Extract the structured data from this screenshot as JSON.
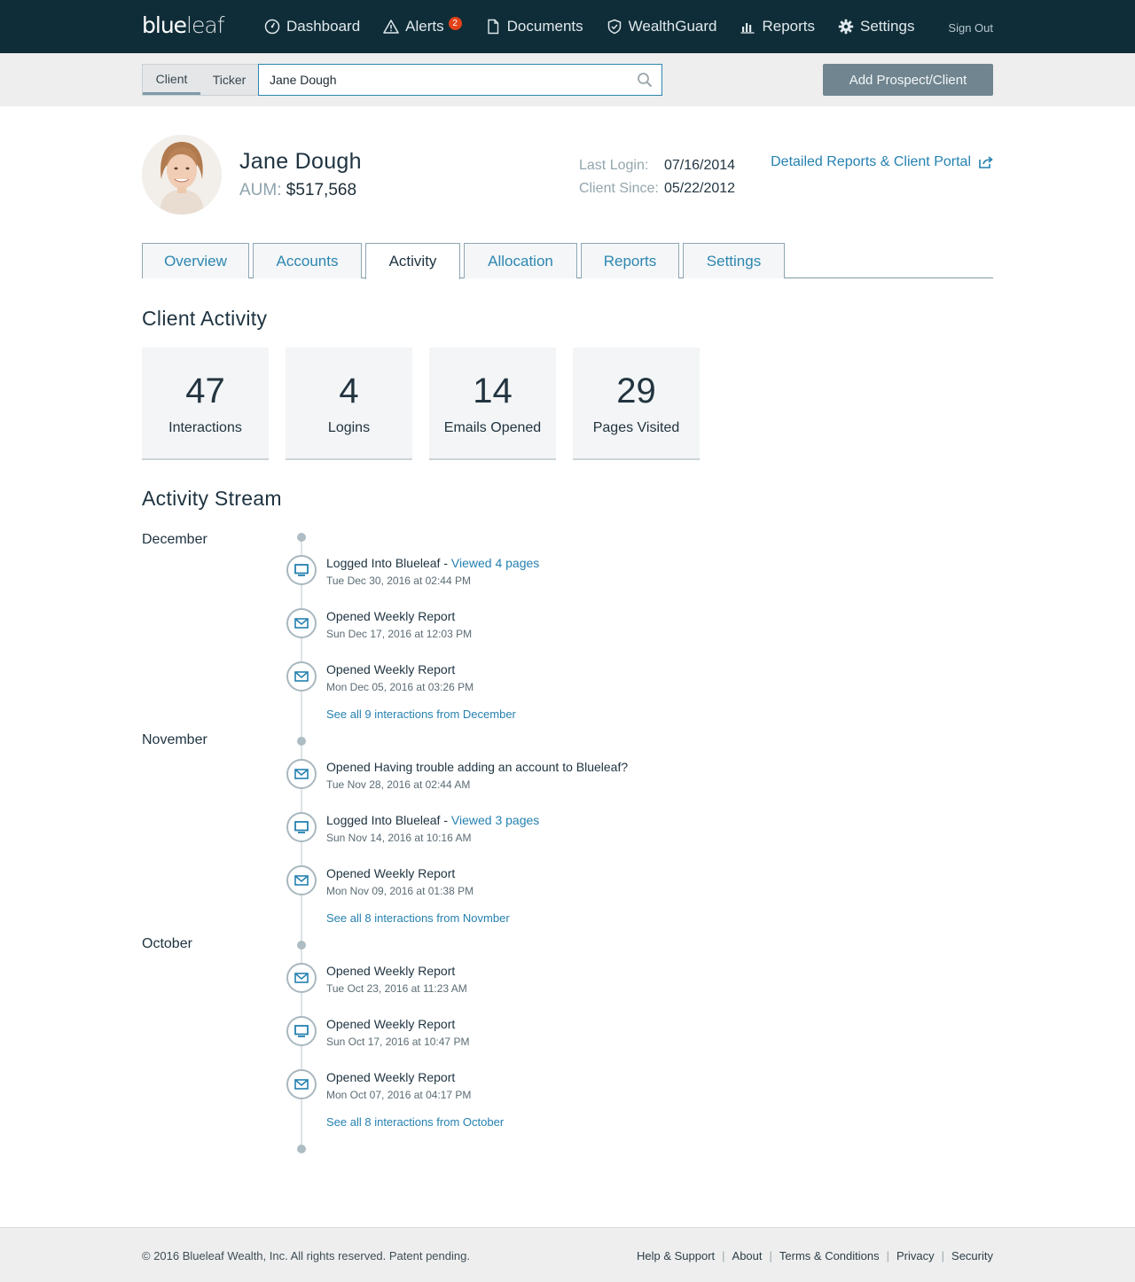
{
  "nav": {
    "logo_bold": "blue",
    "logo_thin": "leaf",
    "items": [
      {
        "label": "Dashboard",
        "icon": "dashboard-icon"
      },
      {
        "label": "Alerts",
        "icon": "alert-icon",
        "badge": "2"
      },
      {
        "label": "Documents",
        "icon": "document-icon"
      },
      {
        "label": "WealthGuard",
        "icon": "shield-icon"
      },
      {
        "label": "Reports",
        "icon": "bar-chart-icon"
      },
      {
        "label": "Settings",
        "icon": "gear-icon"
      }
    ],
    "sign_out": "Sign Out"
  },
  "search": {
    "toggle": [
      "Client",
      "Ticker"
    ],
    "active_toggle": "Client",
    "value": "Jane Dough",
    "add_button": "Add Prospect/Client"
  },
  "client": {
    "name": "Jane Dough",
    "aum_label": "AUM:",
    "aum_value": "$517,568",
    "last_login_label": "Last Login:",
    "last_login": "07/16/2014",
    "client_since_label": "Client Since:",
    "client_since": "05/22/2012",
    "portal_link": "Detailed Reports & Client Portal"
  },
  "tabs": [
    "Overview",
    "Accounts",
    "Activity",
    "Allocation",
    "Reports",
    "Settings"
  ],
  "active_tab": "Activity",
  "activity": {
    "heading": "Client Activity",
    "stats": [
      {
        "value": "47",
        "label": "Interactions"
      },
      {
        "value": "4",
        "label": "Logins"
      },
      {
        "value": "14",
        "label": "Emails Opened"
      },
      {
        "value": "29",
        "label": "Pages Visited"
      }
    ]
  },
  "stream": {
    "heading": "Activity Stream",
    "months": [
      {
        "name": "December",
        "events": [
          {
            "icon": "monitor-icon",
            "title": "Logged Into Blueleaf - ",
            "link": "Viewed 4 pages",
            "time": "Tue Dec 30, 2016 at 02:44 PM"
          },
          {
            "icon": "envelope-icon",
            "title": "Opened Weekly Report",
            "link": "",
            "time": "Sun Dec 17, 2016 at 12:03 PM"
          },
          {
            "icon": "envelope-icon",
            "title": "Opened Weekly Report",
            "link": "",
            "time": "Mon Dec 05, 2016 at 03:26 PM"
          }
        ],
        "see_all": "See all 9 interactions from December"
      },
      {
        "name": "November",
        "events": [
          {
            "icon": "envelope-icon",
            "title": "Opened Having trouble adding an account to Blueleaf?",
            "link": "",
            "time": "Tue Nov 28, 2016 at 02:44 AM"
          },
          {
            "icon": "monitor-icon",
            "title": "Logged Into Blueleaf - ",
            "link": "Viewed 3 pages",
            "time": "Sun Nov 14, 2016 at 10:16 AM"
          },
          {
            "icon": "envelope-icon",
            "title": "Opened Weekly Report",
            "link": "",
            "time": "Mon Nov 09, 2016 at 01:38 PM"
          }
        ],
        "see_all": "See all 8 interactions from Novmber"
      },
      {
        "name": "October",
        "events": [
          {
            "icon": "envelope-icon",
            "title": "Opened Weekly Report",
            "link": "",
            "time": "Tue Oct 23, 2016 at 11:23 AM"
          },
          {
            "icon": "monitor-icon",
            "title": "Opened Weekly Report",
            "link": "",
            "time": "Sun Oct 17, 2016 at 10:47 PM"
          },
          {
            "icon": "envelope-icon",
            "title": "Opened Weekly Report",
            "link": "",
            "time": "Mon Oct 07, 2016 at 04:17 PM"
          }
        ],
        "see_all": "See all 8 interactions from October"
      }
    ]
  },
  "footer": {
    "copyright": "© 2016 Blueleaf Wealth, Inc. All rights reserved. Patent pending.",
    "links": [
      "Help & Support",
      "About",
      "Terms & Conditions",
      "Privacy",
      "Security"
    ]
  },
  "colors": {
    "nav_bg": "#0f2d38",
    "accent": "#2581b0",
    "badge": "#e3421a",
    "button": "#70858f"
  }
}
